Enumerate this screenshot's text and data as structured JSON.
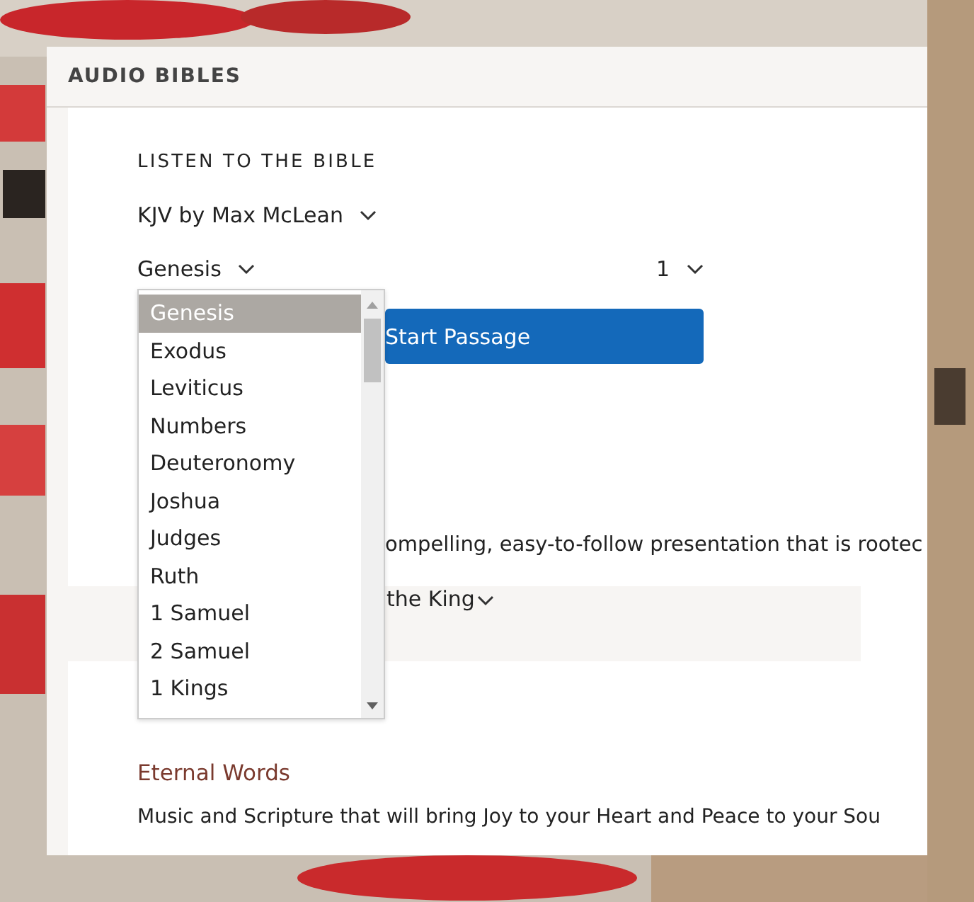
{
  "panel": {
    "title": "AUDIO BIBLES"
  },
  "player": {
    "heading": "LISTEN TO THE BIBLE",
    "version": "KJV by Max McLean",
    "book": "Genesis",
    "chapter": "1",
    "button": "Start Passage"
  },
  "book_dropdown": {
    "expanded": true,
    "items": [
      {
        "label": "Genesis",
        "selected": true
      },
      {
        "label": "Exodus",
        "selected": false
      },
      {
        "label": "Leviticus",
        "selected": false
      },
      {
        "label": "Numbers",
        "selected": false
      },
      {
        "label": "Deuteronomy",
        "selected": false
      },
      {
        "label": "Joshua",
        "selected": false
      },
      {
        "label": "Judges",
        "selected": false
      },
      {
        "label": "Ruth",
        "selected": false
      },
      {
        "label": "1 Samuel",
        "selected": false
      },
      {
        "label": "2 Samuel",
        "selected": false
      },
      {
        "label": "1 Kings",
        "selected": false
      }
    ]
  },
  "partly_hidden": {
    "description": "ompelling, easy-to-follow presentation that is rootec",
    "selector": "the King"
  },
  "section": {
    "title": "Eternal Words",
    "text": "Music and Scripture that will bring Joy to your Heart and Peace to your Sou"
  }
}
